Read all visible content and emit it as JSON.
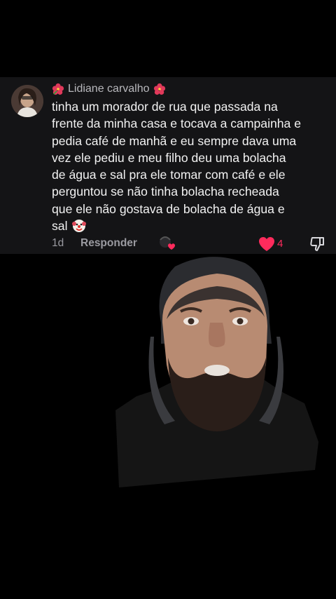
{
  "comment": {
    "author": "Lidiane carvalho",
    "author_decoration_icon": "hibiscus-emoji",
    "text": "tinha um morador de rua que passada na\nfrente da minha casa e tocava a campainha e\npedia café de manhã e eu sempre dava uma\nvez ele pediu e meu filho deu uma bolacha\nde água e sal pra ele tomar com café e ele\nperguntou se não tinha bolacha recheada\nque ele não gostava de bolacha de água e\nsal",
    "trailing_emoji": "clown-emoji",
    "age": "1d",
    "reply_label": "Responder",
    "like_count": "4",
    "liked": true
  },
  "colors": {
    "card_background": "#141416",
    "like_accent": "#ff2b5c",
    "muted_text": "#9a9aa0"
  }
}
